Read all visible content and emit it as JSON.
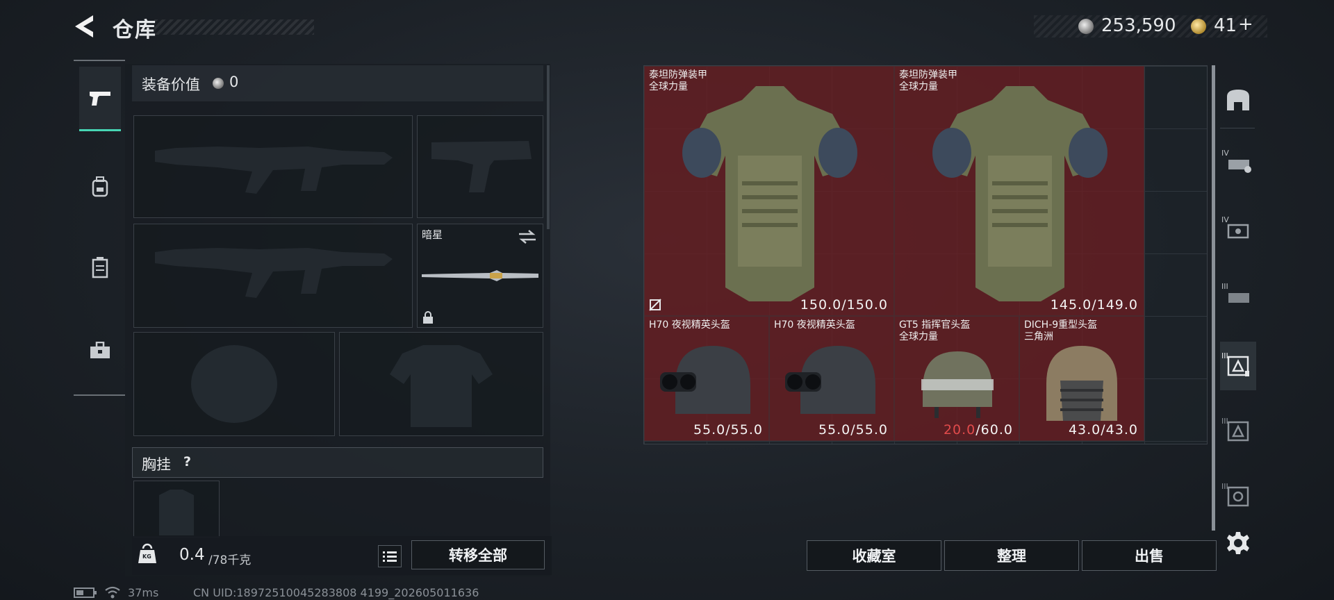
{
  "header": {
    "title": "仓库",
    "silver": "253,590",
    "gold": "41",
    "gold_add": "+"
  },
  "left_nav": {
    "items": [
      {
        "name": "weapon-tab",
        "active": true
      },
      {
        "name": "backpack-tab",
        "active": false
      },
      {
        "name": "container-tab",
        "active": false
      },
      {
        "name": "toolbox-tab",
        "active": false
      }
    ]
  },
  "equipment": {
    "value_label": "装备价值",
    "value": "0",
    "melee_name": "暗星",
    "chest_label": "胸挂",
    "chest_help": "?",
    "weight": "0.4",
    "weight_max": "/78千克",
    "weight_icon": "KG",
    "transfer_all": "转移全部"
  },
  "items": [
    {
      "name": "泰坦防弹装甲",
      "sub": "全球力量",
      "dur": "150.0",
      "dur_max": "/150.0"
    },
    {
      "name": "泰坦防弹装甲",
      "sub": "全球力量",
      "dur": "145.0",
      "dur_max": "/149.0"
    },
    {
      "name": "H70 夜视精英头盔",
      "sub": "",
      "dur": "55.0",
      "dur_max": "/55.0"
    },
    {
      "name": "H70 夜视精英头盔",
      "sub": "",
      "dur": "55.0",
      "dur_max": "/55.0"
    },
    {
      "name": "GT5 指挥官头盔",
      "sub": "全球力量",
      "dur": "20.0",
      "dur_max": "/60.0"
    },
    {
      "name": "DICH-9重型头盔",
      "sub": "三角洲",
      "dur": "43.0",
      "dur_max": "/43.0"
    }
  ],
  "right_tabs": [
    "IV",
    "IV",
    "III",
    "III",
    "III",
    "III"
  ],
  "actions": {
    "vault": "收藏室",
    "sort": "整理",
    "sell": "出售"
  },
  "status": {
    "ping": "37ms",
    "uid": "CN UID:18972510045283808 4199_202605011636"
  },
  "colors": {
    "accent": "#47d6b4",
    "item_bg": "#6e1e22",
    "low_dur": "#e14b4b"
  }
}
